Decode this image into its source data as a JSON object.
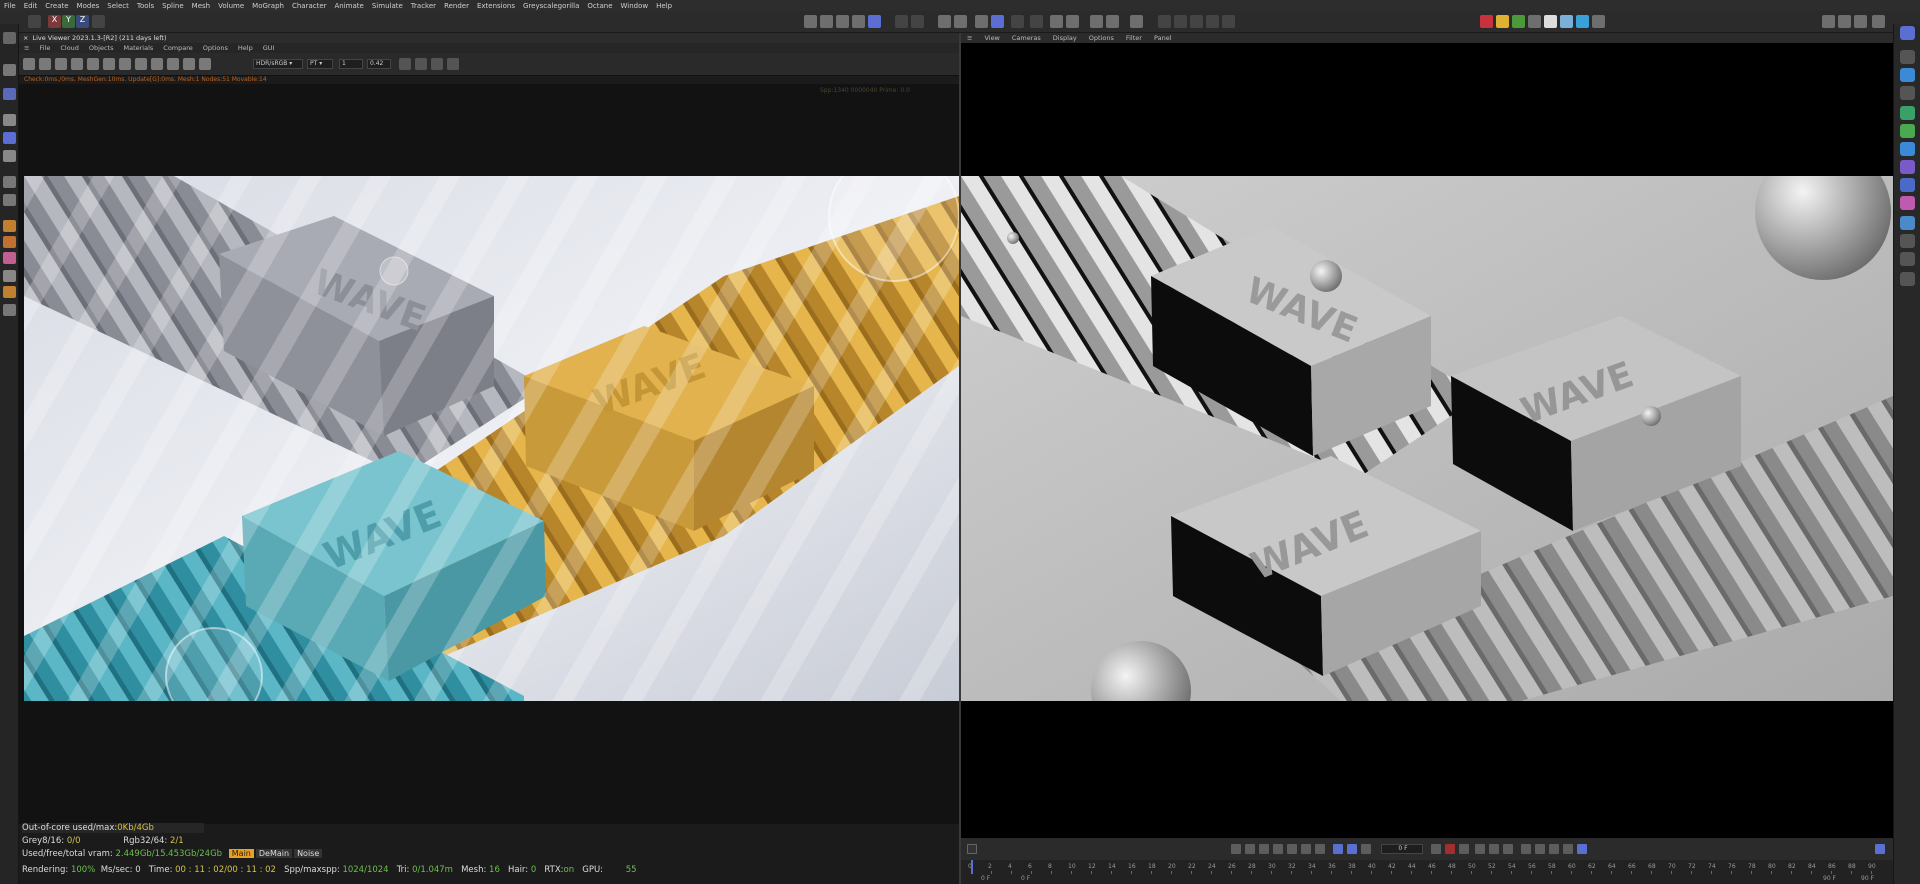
{
  "menubar": [
    "File",
    "Edit",
    "Create",
    "Modes",
    "Select",
    "Tools",
    "Spline",
    "Mesh",
    "Volume",
    "MoGraph",
    "Character",
    "Animate",
    "Simulate",
    "Tracker",
    "Render",
    "Extensions",
    "Greyscalegorilla",
    "Octane",
    "Window",
    "Help"
  ],
  "axes": {
    "x": "X",
    "y": "Y",
    "z": "Z"
  },
  "live_viewer": {
    "title": "Live Viewer 2023.1.3-[R2] (211 days left)",
    "menu": [
      "File",
      "Cloud",
      "Objects",
      "Materials",
      "Compare",
      "Options",
      "Help",
      "GUI"
    ],
    "color_space": "HDR/sRGB",
    "kernel": "PT",
    "frame": "1",
    "value": "0.42",
    "status": "Check:0ms./0ms. MeshGen:10ms. Update[G]:0ms. Mesh:1 Nodes:51 Movable:14",
    "status_right": "Spp:1340 0000040  Prime: 0.0"
  },
  "viewport": {
    "menu": [
      "View",
      "Cameras",
      "Display",
      "Options",
      "Filter",
      "Panel"
    ]
  },
  "stats": {
    "out_of_core_label": "Out-of-core used/max:",
    "out_of_core_value": "0Kb/4Gb",
    "grey_label": "Grey8/16:",
    "grey_value": "0/0",
    "rgb_label": "Rgb32/64:",
    "rgb_value": "2/1",
    "vram_label": "Used/free/total vram:",
    "vram_value": "2.449Gb/15.453Gb/24Gb",
    "modes": [
      "Main",
      "DeMain",
      "Noise"
    ],
    "rendering_label": "Rendering:",
    "rendering_value": "100%",
    "ms_label": "Ms/sec:",
    "ms_value": "0",
    "time_label": "Time:",
    "time_value": "00 : 11 : 02/00 : 11 : 02",
    "spp_label": "Spp/maxspp:",
    "spp_value": "1024/1024",
    "tri_label": "Tri:",
    "tri_value": "0/1.047m",
    "mesh_label": "Mesh:",
    "mesh_value": "16",
    "hair_label": "Hair:",
    "hair_value": "0",
    "rtx_label": "RTX:",
    "rtx_value": "on",
    "gpu_label": "GPU:",
    "gpu_value": "55"
  },
  "timeline": {
    "current_frame": "0 F",
    "start_frame": "0 F",
    "start_frame2": "0 F",
    "end_frame": "90 F",
    "end_frame2": "90 F",
    "ticks": [
      "0",
      "2",
      "4",
      "6",
      "8",
      "10",
      "12",
      "14",
      "16",
      "18",
      "20",
      "22",
      "24",
      "26",
      "28",
      "30",
      "32",
      "34",
      "36",
      "38",
      "40",
      "42",
      "44",
      "46",
      "48",
      "50",
      "52",
      "54",
      "56",
      "58",
      "60",
      "62",
      "64",
      "66",
      "68",
      "70",
      "72",
      "74",
      "76",
      "78",
      "80",
      "82",
      "84",
      "86",
      "88",
      "90"
    ]
  },
  "soap_text": "WAVE",
  "colors": {
    "accent": "#5b6ed1",
    "soap_blue": "#6fbcc8",
    "soap_yellow": "#e0b04a",
    "soap_grey": "#a6a8b2",
    "status_orange": "#c0621e",
    "stat_green": "#6cc04a"
  }
}
